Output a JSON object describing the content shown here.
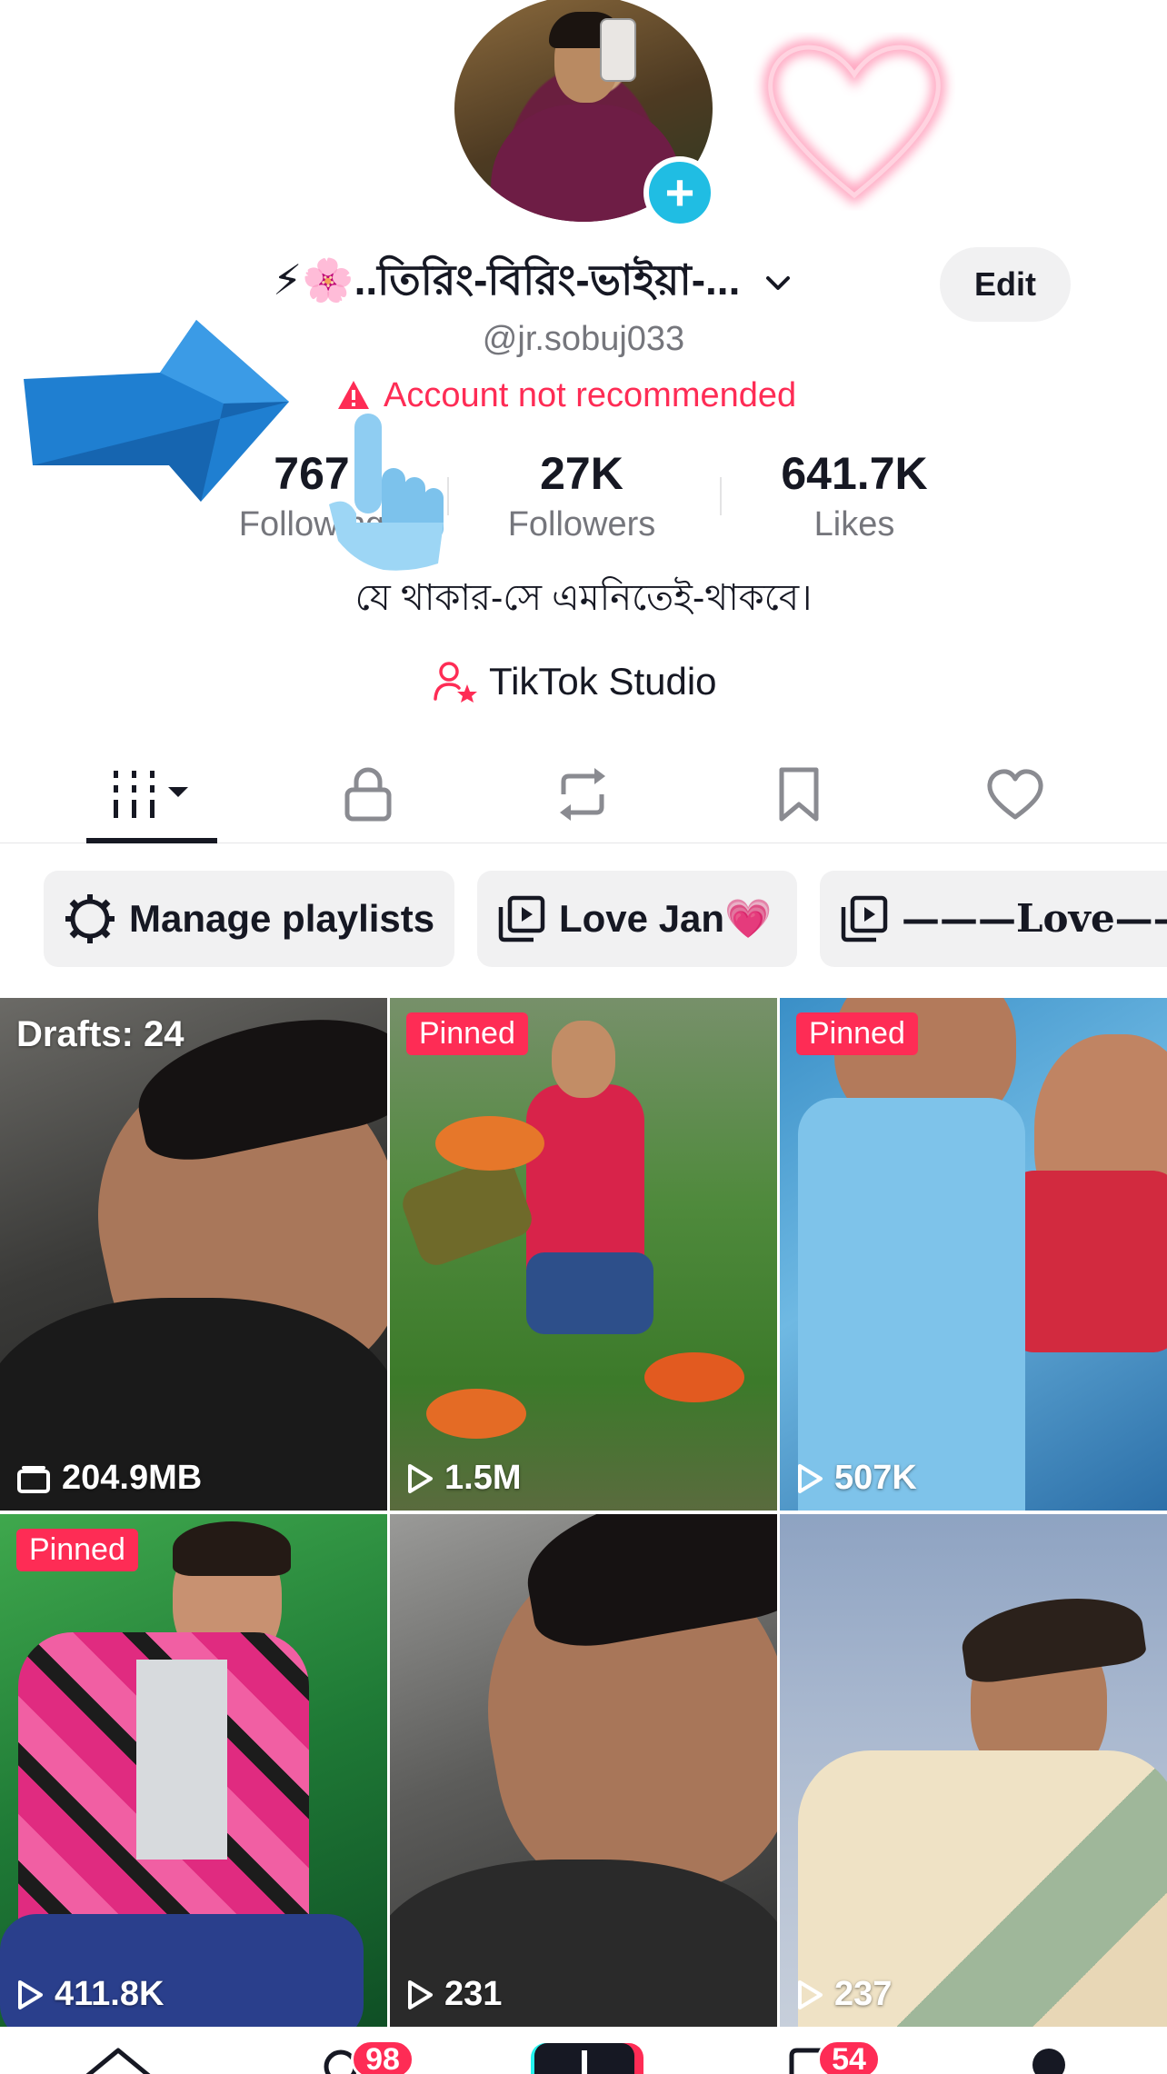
{
  "profile": {
    "display_name": "⚡🌸..তিরিং-বিরিং-ভাইয়া-...",
    "username": "@jr.sobuj033",
    "edit_label": "Edit",
    "warning": "Account not recommended",
    "bio": "যে থাকার-সে এমনিতেই-থাকবে।",
    "studio_label": "TikTok Studio"
  },
  "stats": [
    {
      "value": "767",
      "label": "Following"
    },
    {
      "value": "27K",
      "label": "Followers"
    },
    {
      "value": "641.7K",
      "label": "Likes"
    }
  ],
  "tabs": [
    "videos",
    "private",
    "reposts",
    "favorites",
    "liked"
  ],
  "playlists": {
    "manage_label": "Manage playlists",
    "items": [
      "Love Jan💗",
      "———Love———❤️"
    ]
  },
  "videos": [
    {
      "top_label": "Drafts: 24",
      "bottom_label": "204.9MB",
      "kind": "drafts"
    },
    {
      "top_label": "Pinned",
      "bottom_label": "1.5M",
      "kind": "pinned"
    },
    {
      "top_label": "Pinned",
      "bottom_label": "507K",
      "kind": "pinned"
    },
    {
      "top_label": "Pinned",
      "bottom_label": "411.8K",
      "kind": "pinned"
    },
    {
      "top_label": "",
      "bottom_label": "231",
      "kind": "video"
    },
    {
      "top_label": "",
      "bottom_label": "237",
      "kind": "video"
    }
  ],
  "nav": {
    "inbox_badge": "98",
    "messages_badge": "54"
  },
  "colors": {
    "accent": "#fe2c55",
    "add_button": "#20bde3",
    "muted_text": "#75767c"
  }
}
